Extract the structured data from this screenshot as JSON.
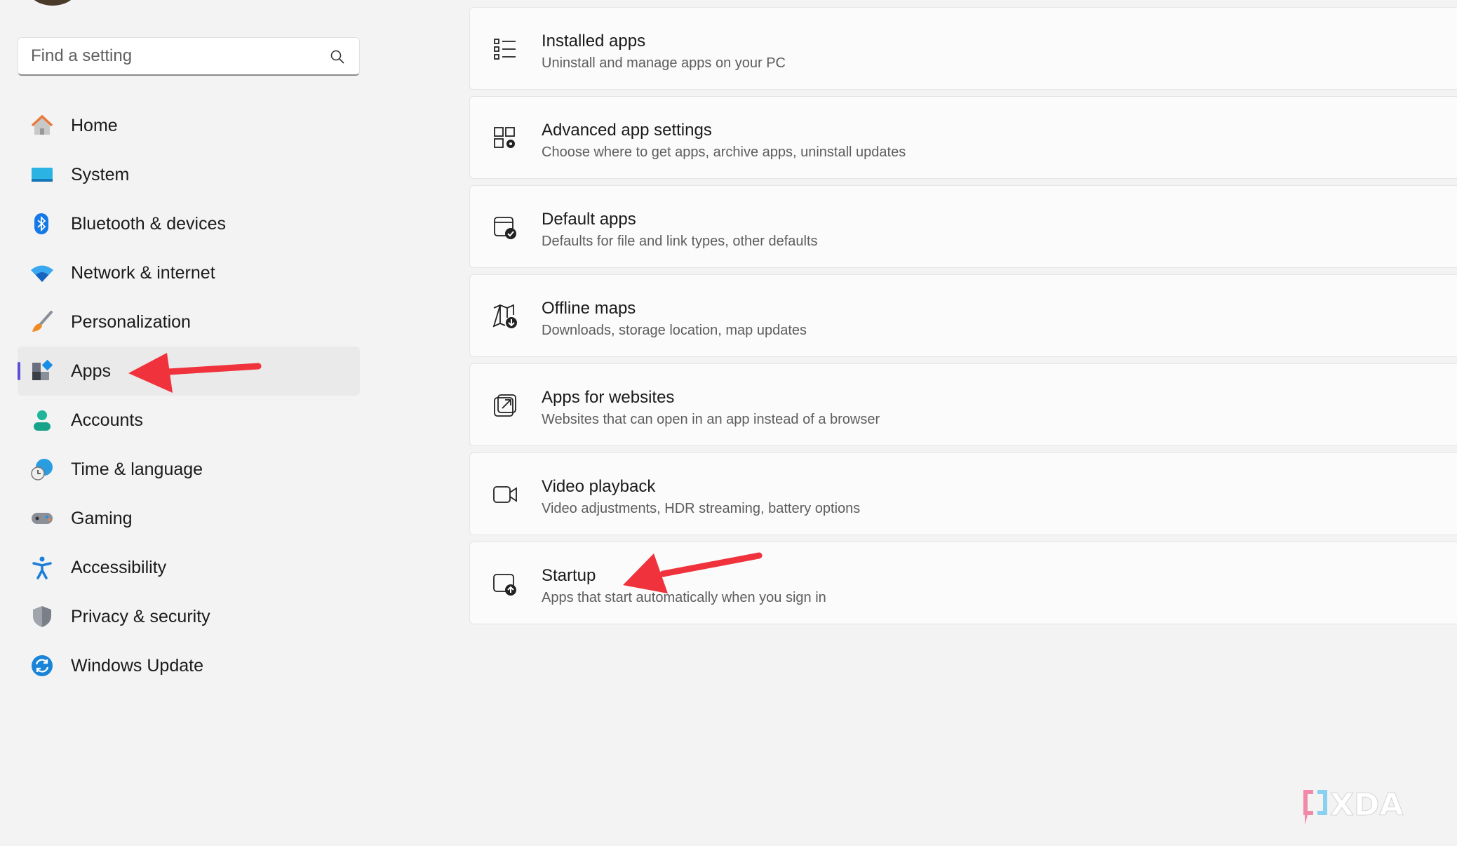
{
  "search": {
    "placeholder": "Find a setting",
    "icon": "search-icon"
  },
  "sidebar": {
    "items": [
      {
        "label": "Home",
        "icon": "home-icon",
        "color": "#e8793a"
      },
      {
        "label": "System",
        "icon": "monitor-icon",
        "color": "#1c9fd6"
      },
      {
        "label": "Bluetooth & devices",
        "icon": "bluetooth-icon",
        "color": "#1478e6"
      },
      {
        "label": "Network & internet",
        "icon": "wifi-icon",
        "color": "#1a8ee6"
      },
      {
        "label": "Personalization",
        "icon": "brush-icon",
        "color": "#f08a24"
      },
      {
        "label": "Apps",
        "icon": "apps-icon",
        "color": "#5a6070",
        "selected": true
      },
      {
        "label": "Accounts",
        "icon": "person-icon",
        "color": "#1fb59a"
      },
      {
        "label": "Time & language",
        "icon": "globe-clock-icon",
        "color": "#2a9de0"
      },
      {
        "label": "Gaming",
        "icon": "gamepad-icon",
        "color": "#8a8f98"
      },
      {
        "label": "Accessibility",
        "icon": "accessibility-icon",
        "color": "#1a7ed8"
      },
      {
        "label": "Privacy & security",
        "icon": "shield-icon",
        "color": "#7a7f88"
      },
      {
        "label": "Windows Update",
        "icon": "update-icon",
        "color": "#1a84d8"
      }
    ]
  },
  "main": {
    "cards": [
      {
        "title": "Installed apps",
        "subtitle": "Uninstall and manage apps on your PC",
        "icon": "list-icon"
      },
      {
        "title": "Advanced app settings",
        "subtitle": "Choose where to get apps, archive apps, uninstall updates",
        "icon": "apps-gear-icon"
      },
      {
        "title": "Default apps",
        "subtitle": "Defaults for file and link types, other defaults",
        "icon": "window-check-icon"
      },
      {
        "title": "Offline maps",
        "subtitle": "Downloads, storage location, map updates",
        "icon": "map-download-icon"
      },
      {
        "title": "Apps for websites",
        "subtitle": "Websites that can open in an app instead of a browser",
        "icon": "open-external-icon"
      },
      {
        "title": "Video playback",
        "subtitle": "Video adjustments, HDR streaming, battery options",
        "icon": "video-camera-icon"
      },
      {
        "title": "Startup",
        "subtitle": "Apps that start automatically when you sign in",
        "icon": "startup-icon"
      }
    ]
  },
  "annotations": {
    "arrow_color": "#f0323c"
  },
  "watermark": {
    "text": "XDA"
  }
}
